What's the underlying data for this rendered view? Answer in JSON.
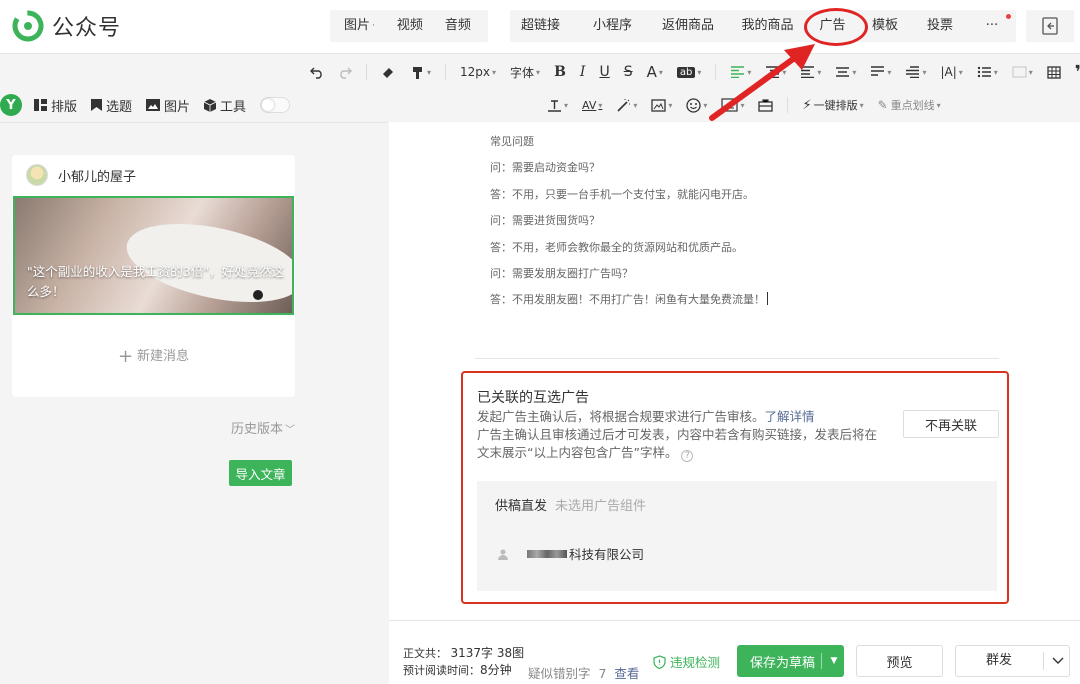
{
  "app": {
    "name": "公众号",
    "brand_color": "#3db35a",
    "highlight_color": "#d9331f"
  },
  "header": {
    "group1": [
      {
        "label": "图片",
        "dropdown": true
      },
      {
        "label": "视频",
        "dropdown": false
      },
      {
        "label": "音频",
        "dropdown": false
      }
    ],
    "group2": [
      {
        "label": "超链接"
      },
      {
        "label": "小程序"
      },
      {
        "label": "返佣商品"
      },
      {
        "label": "我的商品"
      },
      {
        "label": "广告"
      },
      {
        "label": "模板"
      },
      {
        "label": "投票"
      },
      {
        "label": "···"
      }
    ]
  },
  "format_toolbar": {
    "font_size": "12px",
    "font_family": "字体",
    "one_click_layout": "一键排版",
    "key_underline": "重点划线"
  },
  "left_nav": {
    "items": [
      {
        "label": "排版",
        "icon": "layout-icon"
      },
      {
        "label": "选题",
        "icon": "bookmark-icon"
      },
      {
        "label": "图片",
        "icon": "image-icon"
      },
      {
        "label": "工具",
        "icon": "cube-icon"
      }
    ]
  },
  "article_card": {
    "account_name": "小郁儿的屋子",
    "cover_title": "\"这个副业的收入是我工资的3倍\"，好处竟然这么多！",
    "new_message": "新建消息"
  },
  "history_label": "历史版本",
  "import_label": "导入文章",
  "content": {
    "lines": [
      "常见问题",
      "问：需要启动资金吗？",
      "答：不用，只要一台手机一个支付宝，就能闪电开店。",
      "问：需要进货囤货吗？",
      "答：不用，老师会教你最全的货源网站和优质产品。",
      "问：需要发朋友圈打广告吗？",
      "答：不用发朋友圈！不用打广告！闲鱼有大量免费流量！"
    ]
  },
  "ad_panel": {
    "title": "已关联的互选广告",
    "desc1": "发起广告主确认后，将根据合规要求进行广告审核。",
    "learn_more": "了解详情",
    "desc2": "广告主确认且审核通过后才可发表，内容中若含有购买链接，发表后将在文末展示“以上内容包含广告”字样。",
    "unlink_button": "不再关联",
    "type_label": "供稿直发",
    "type_hint": "未选用广告组件",
    "company": "科技有限公司"
  },
  "bottom": {
    "word_count_label": "正文共：",
    "word_count_value": "3137字 38图",
    "read_time_label": "预计阅读时间：",
    "read_time_value": "8分钟",
    "typo_label": "疑似错别字",
    "typo_count": "7",
    "typo_link": "查看",
    "violation_check": "违规检测",
    "save_draft": "保存为草稿",
    "preview": "预览",
    "publish": "群发"
  }
}
